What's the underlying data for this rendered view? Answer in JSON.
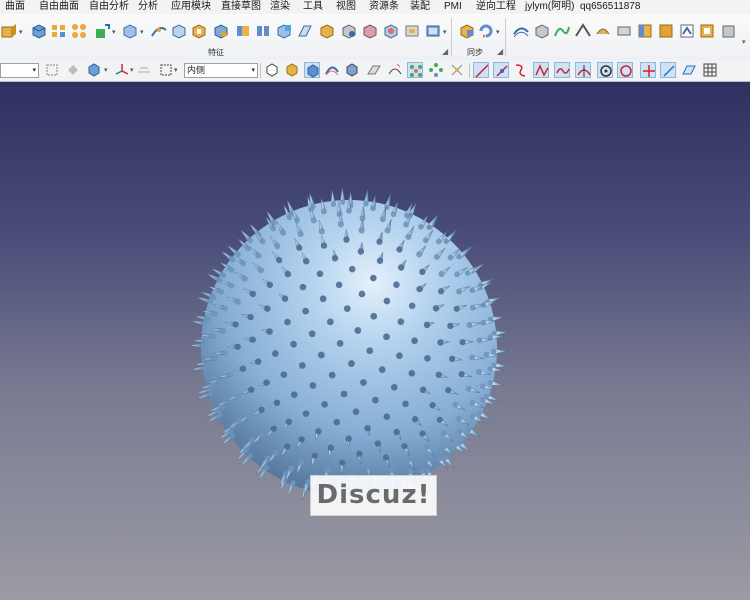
{
  "menu": [
    "曲面",
    "自由曲面",
    "自由分析",
    "分析",
    "应用模块",
    "直接草图",
    "渲染",
    "工具",
    "视图",
    "资源条",
    "装配",
    "PMI",
    "逆向工程",
    "jylym(阿明)",
    "qq656511878"
  ],
  "ribbon": {
    "group_features_label": "特征",
    "group_sync_label": "同步"
  },
  "toolbar": {
    "filter_value": "",
    "side_combo_value": "内侧"
  },
  "watermark": {
    "text": "Discuz!"
  },
  "colors": {
    "sphere_light": "#cfe4f6",
    "sphere_mid": "#8fb8dc",
    "sphere_dark": "#3e5f82",
    "viewport_top": "#2f3060",
    "viewport_bottom": "#9b9ba4"
  }
}
